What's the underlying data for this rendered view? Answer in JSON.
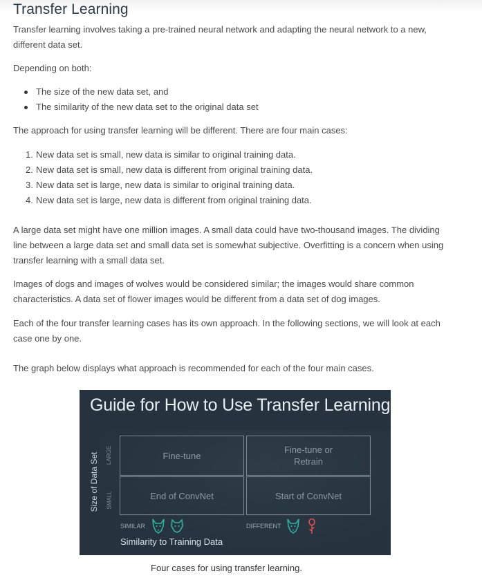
{
  "title": "Transfer Learning",
  "intro": "Transfer learning involves taking a pre-trained neural network and adapting the neural network to a new, different data set.",
  "depending": "Depending on both:",
  "bullets": [
    "The size of the new data set, and",
    "The similarity of the new data set to the original data set"
  ],
  "approach": "The approach for using transfer learning will be different. There are four main cases:",
  "cases": [
    {
      "num": "1.",
      "text": "New data set is small, new data is similar to original training data."
    },
    {
      "num": "2.",
      "text": "New data set is small, new data is different from original training data."
    },
    {
      "num": "3.",
      "text": "New data set is large, new data is similar to original training data."
    },
    {
      "num": "4.",
      "text": "New data set is large, new data is different from original training data."
    }
  ],
  "para_large": "A large data set might have one million images. A small data could have two-thousand images. The dividing line between a large data set and small data set is somewhat subjective. Overfitting is a concern when using transfer learning with a small data set.",
  "para_dogs": "Images of dogs and images of wolves would be considered similar; the images would share common characteristics. A data set of flower images would be different from a data set of dog images.",
  "para_each": "Each of the four transfer learning cases has its own approach. In the following sections, we will look at each case one by one.",
  "para_graph": "The graph below displays what approach is recommended for each of the four main cases.",
  "figure": {
    "title": "Guide for How to Use Transfer Learning",
    "y_axis": "Size of Data Set",
    "y_large": "LARGE",
    "y_small": "SMALL",
    "x_similar": "SIMILAR",
    "x_different": "DIFFERENT",
    "x_axis": "Similarity to Training Data",
    "cells": {
      "large_similar": "Fine-tune",
      "large_different_line1": "Fine-tune or",
      "large_different_line2": "Retrain",
      "small_similar": "End of ConvNet",
      "small_different": "Start of ConvNet"
    },
    "colors": {
      "background": "#26333f",
      "icon_teal": "#2bb3a0",
      "icon_red": "#e0514f"
    }
  },
  "caption": "Four cases for using transfer learning."
}
